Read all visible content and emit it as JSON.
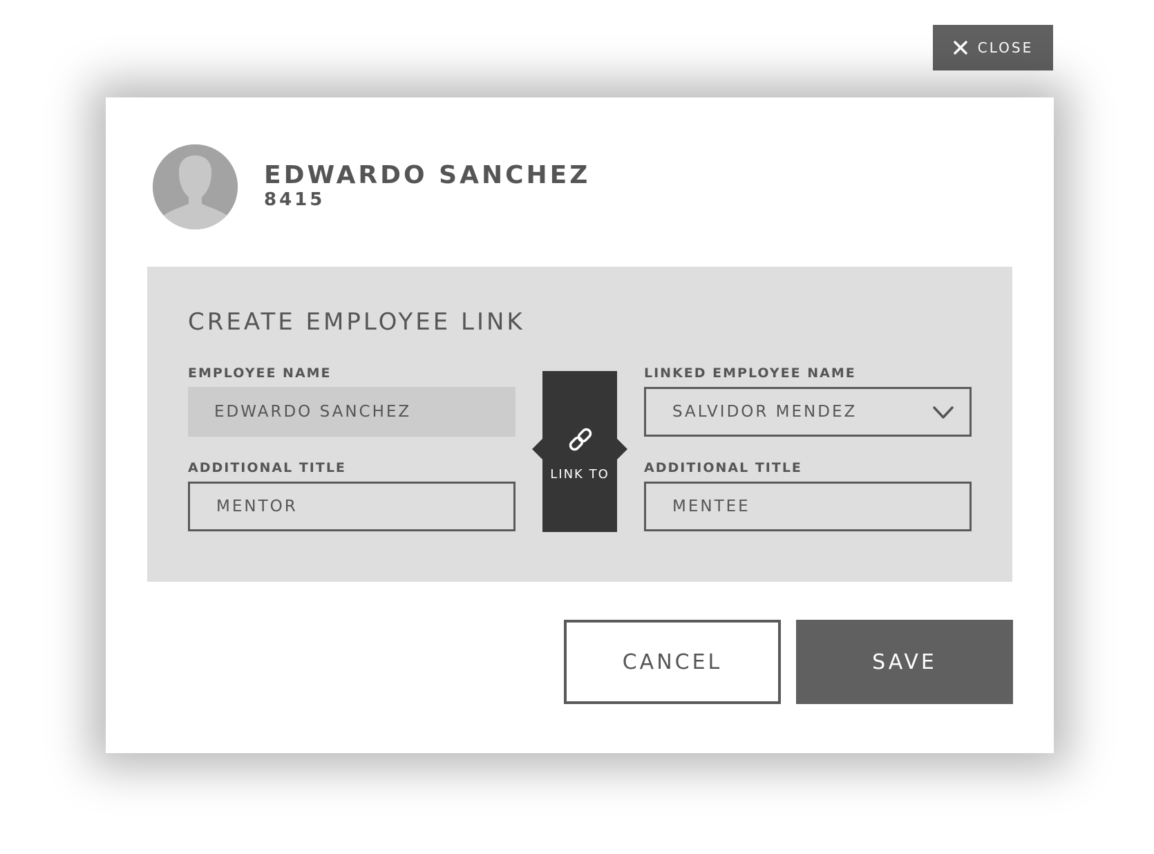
{
  "close_button": {
    "label": "CLOSE",
    "icon": "close-icon"
  },
  "profile": {
    "name": "EDWARDO SANCHEZ",
    "id": "8415",
    "avatar_icon": "user-silhouette-icon"
  },
  "link_panel": {
    "title": "CREATE EMPLOYEE LINK",
    "employee_name": {
      "label": "EMPLOYEE NAME",
      "value": "EDWARDO SANCHEZ"
    },
    "employee_title": {
      "label": "ADDITIONAL TITLE",
      "value": "MENTOR"
    },
    "link_badge": {
      "label": "LINK TO",
      "icon": "chain-link-icon"
    },
    "linked_employee_name": {
      "label": "LINKED EMPLOYEE NAME",
      "value": "SALVIDOR MENDEZ",
      "icon": "chevron-down-icon"
    },
    "linked_title": {
      "label": "ADDITIONAL TITLE",
      "value": "MENTEE"
    }
  },
  "actions": {
    "cancel_label": "CANCEL",
    "save_label": "SAVE"
  },
  "colors": {
    "button_dark": "#606060",
    "badge_dark": "#363636",
    "panel_bg": "#dedede",
    "readonly_field_bg": "#cccccc",
    "text": "#555555",
    "avatar_bg": "#a3a3a3"
  }
}
